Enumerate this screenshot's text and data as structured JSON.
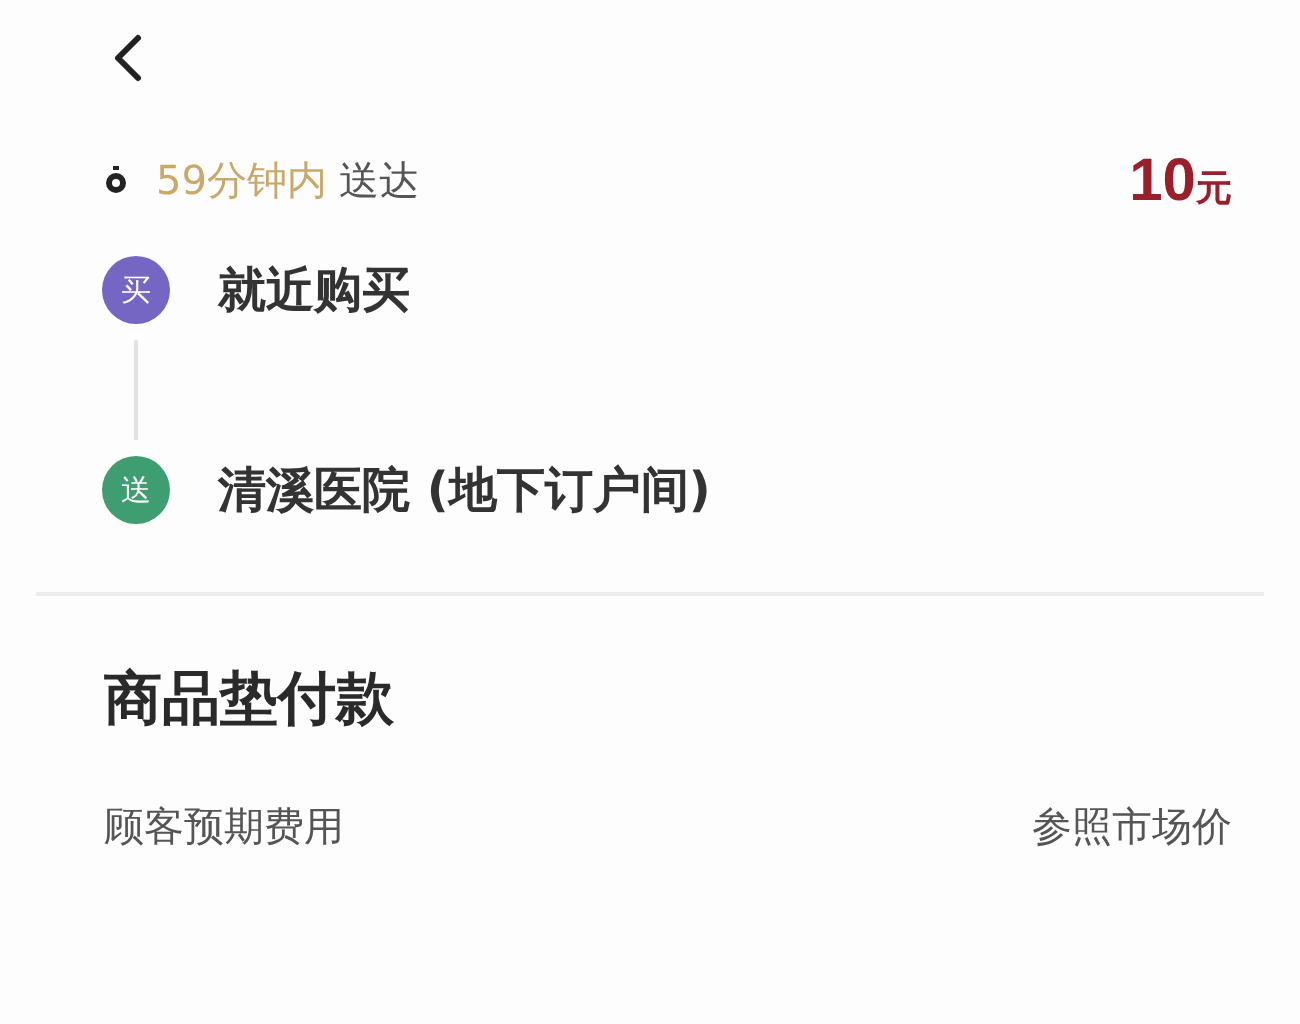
{
  "delivery": {
    "time": "59分钟内",
    "suffix": "送达",
    "price": "10",
    "currency": "元"
  },
  "stops": [
    {
      "badge": "买",
      "color": "#7566c4",
      "label": "就近购买"
    },
    {
      "badge": "送",
      "color": "#3f9d72",
      "label": "清溪医院 (地下订户间)"
    }
  ],
  "section": {
    "title": "商品垫付款",
    "rows": [
      {
        "label": "顾客预期费用",
        "value": "参照市场价"
      }
    ]
  }
}
